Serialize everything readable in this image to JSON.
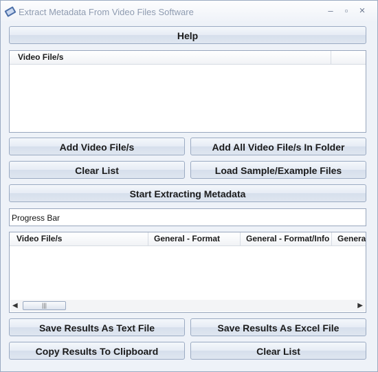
{
  "window": {
    "title": "Extract Metadata From Video Files Software",
    "minimize_glyph": "–",
    "maximize_glyph": "▫",
    "close_glyph": "×",
    "app_icon": "film-reel-icon"
  },
  "buttons": {
    "help": "Help",
    "add_video_files": "Add Video File/s",
    "add_all_in_folder": "Add All Video File/s In Folder",
    "clear_list_top": "Clear List",
    "load_sample": "Load Sample/Example Files",
    "start_extracting": "Start Extracting Metadata",
    "save_text": "Save Results As Text File",
    "save_excel": "Save Results As Excel File",
    "copy_clipboard": "Copy Results To Clipboard",
    "clear_list_bottom": "Clear List"
  },
  "input_list": {
    "columns": [
      "Video File/s"
    ],
    "rows": []
  },
  "progress": {
    "label": "Progress Bar",
    "value": 0
  },
  "results_list": {
    "columns": [
      "Video File/s",
      "General - Format",
      "General - Format/Info",
      "Genera"
    ],
    "rows": []
  },
  "scrollbar": {
    "left_arrow": "◀",
    "right_arrow": "▶",
    "thumb_grip": "|||"
  }
}
